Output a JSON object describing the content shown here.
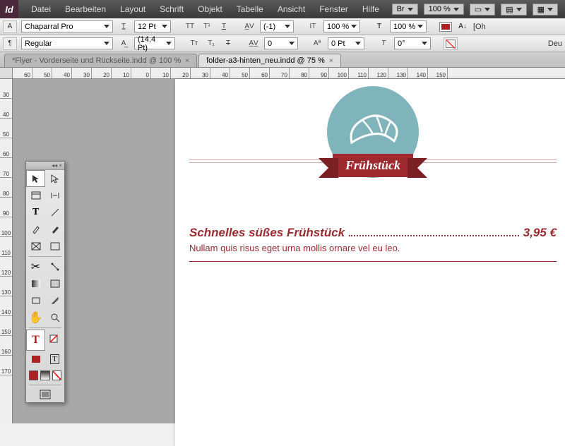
{
  "app": {
    "icon_text": "Id"
  },
  "menu": [
    "Datei",
    "Bearbeiten",
    "Layout",
    "Schrift",
    "Objekt",
    "Tabelle",
    "Ansicht",
    "Fenster",
    "Hilfe"
  ],
  "top_right": {
    "br": "Br",
    "zoom": "100 %"
  },
  "ctrl": {
    "font_family": "Chaparral Pro",
    "font_style": "Regular",
    "font_size": "12 Pt",
    "leading": "(14,4 Pt)",
    "kerning": "(-1)",
    "tracking": "0",
    "vscale": "100 %",
    "baseline": "0 Pt",
    "hscale": "100 %",
    "skew": "0°",
    "lang": "Deu",
    "oh": "[Oh"
  },
  "tabs": [
    {
      "label": "*Flyer - Vorderseite und Rückseite.indd @ 100 %",
      "active": false
    },
    {
      "label": "folder-a3-hinten_neu.indd @ 75 %",
      "active": true
    }
  ],
  "h_ruler": [
    "60",
    "50",
    "40",
    "30",
    "20",
    "10",
    "0",
    "10",
    "20",
    "30",
    "40",
    "50",
    "60",
    "70",
    "80",
    "90",
    "100",
    "110",
    "120",
    "130",
    "140",
    "150"
  ],
  "v_ruler": [
    "30",
    "40",
    "50",
    "60",
    "70",
    "80",
    "90",
    "100",
    "110",
    "120",
    "130",
    "140",
    "150",
    "160",
    "170"
  ],
  "page": {
    "badge_title": "Frühstück",
    "item_title": "Schnelles süßes Frühstück",
    "item_price": "3,95 €",
    "item_desc": "Nullam quis risus eget urna mollis ornare vel eu leo."
  },
  "colors": {
    "brand_red": "#982c30",
    "badge_teal": "#7fb5ba",
    "ribbon": "#9e2a2f"
  }
}
